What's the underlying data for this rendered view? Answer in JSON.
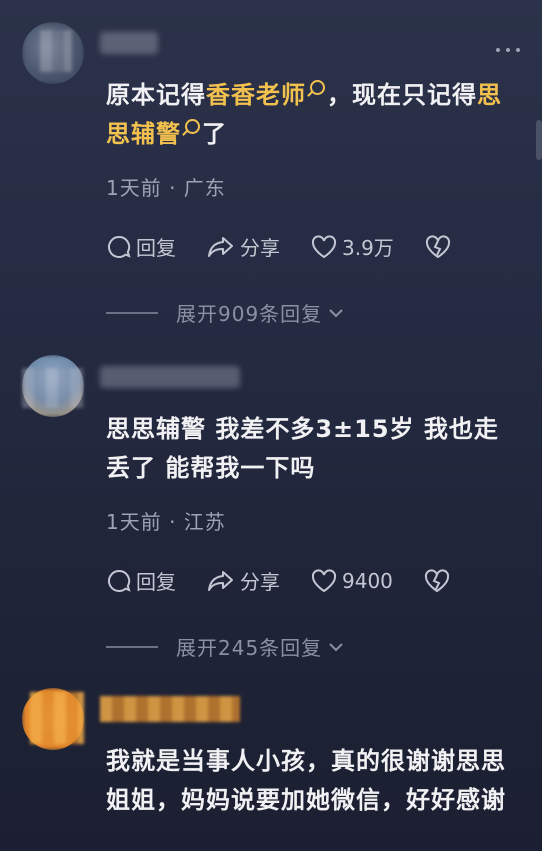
{
  "comments": [
    {
      "text_before": "原本记得",
      "keyword1": "香香老师",
      "text_mid": "，现在只记得",
      "keyword2": "思思辅警",
      "text_after": "了",
      "meta": "1天前 · 广东",
      "reply_label": "回复",
      "share_label": "分享",
      "like_count": "3.9万",
      "expand_label": "展开909条回复"
    },
    {
      "text": "思思辅警 我差不多3±15岁 我也走丢了 能帮我一下吗",
      "meta": "1天前 · 江苏",
      "reply_label": "回复",
      "share_label": "分享",
      "like_count": "9400",
      "expand_label": "展开245条回复"
    },
    {
      "text": "我就是当事人小孩，真的很谢谢思思姐姐，妈妈说要加她微信，好好感谢"
    }
  ],
  "colors": {
    "keyword": "#f2c14e",
    "background": "#252b42"
  }
}
